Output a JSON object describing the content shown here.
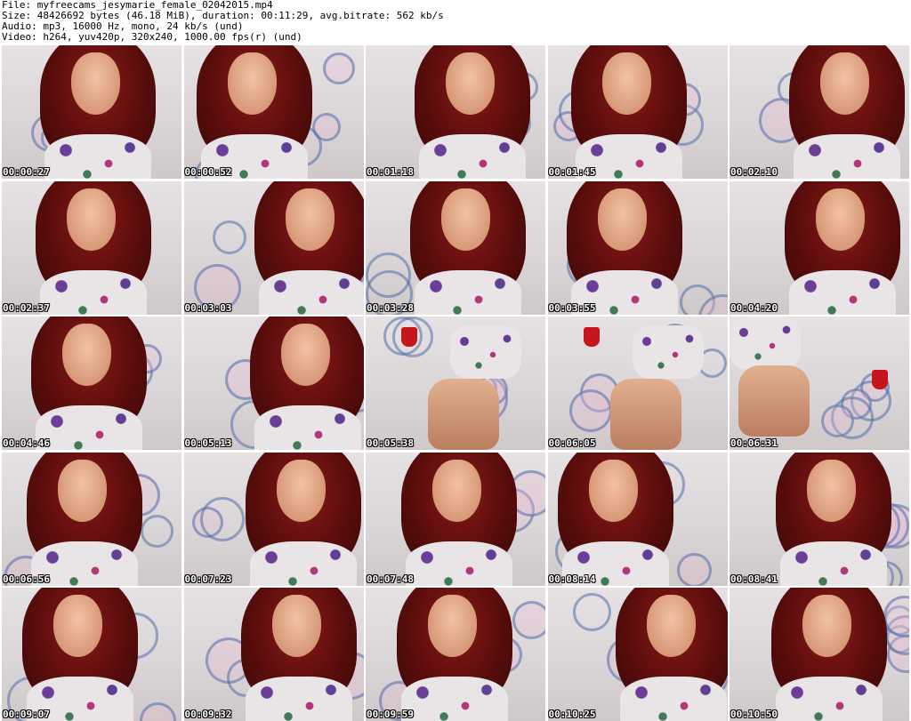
{
  "header": {
    "file_line": "File: myfreecams_jesymarie_female_02042015.mp4",
    "size_line": "Size: 48426692 bytes (46.18 MiB), duration: 00:11:29, avg.bitrate: 562 kb/s",
    "audio_line": "Audio: mp3, 16000 Hz, mono, 24 kb/s (und)",
    "video_line": "Video: h264, yuv420p, 320x240, 1000.00 fps(r) (und)"
  },
  "thumbnails": [
    {
      "timestamp": "00:00:27",
      "scene": "closeup"
    },
    {
      "timestamp": "00:00:52",
      "scene": "closeup"
    },
    {
      "timestamp": "00:01:18",
      "scene": "closeup"
    },
    {
      "timestamp": "00:01:45",
      "scene": "closeup"
    },
    {
      "timestamp": "00:02:10",
      "scene": "closeup"
    },
    {
      "timestamp": "00:02:37",
      "scene": "closeup"
    },
    {
      "timestamp": "00:03:03",
      "scene": "closeup"
    },
    {
      "timestamp": "00:03:28",
      "scene": "closeup"
    },
    {
      "timestamp": "00:03:55",
      "scene": "closeup"
    },
    {
      "timestamp": "00:04:20",
      "scene": "closeup"
    },
    {
      "timestamp": "00:04:46",
      "scene": "closeup"
    },
    {
      "timestamp": "00:05:13",
      "scene": "closeup"
    },
    {
      "timestamp": "00:05:38",
      "scene": "body"
    },
    {
      "timestamp": "00:06:05",
      "scene": "body"
    },
    {
      "timestamp": "00:06:31",
      "scene": "body"
    },
    {
      "timestamp": "00:06:56",
      "scene": "closeup"
    },
    {
      "timestamp": "00:07:23",
      "scene": "closeup"
    },
    {
      "timestamp": "00:07:48",
      "scene": "closeup"
    },
    {
      "timestamp": "00:08:14",
      "scene": "closeup"
    },
    {
      "timestamp": "00:08:41",
      "scene": "closeup"
    },
    {
      "timestamp": "00:09:07",
      "scene": "closeup"
    },
    {
      "timestamp": "00:09:32",
      "scene": "closeup"
    },
    {
      "timestamp": "00:09:59",
      "scene": "closeup"
    },
    {
      "timestamp": "00:10:25",
      "scene": "closeup"
    },
    {
      "timestamp": "00:10:50",
      "scene": "closeup"
    }
  ],
  "colors": {
    "background": "#ffffff",
    "header_text": "#000000",
    "timestamp_text": "#ffffff",
    "timestamp_outline": "#000000",
    "hair": "#7a1614",
    "wall": "#d9d2cf",
    "lamp": "#c4161c"
  }
}
